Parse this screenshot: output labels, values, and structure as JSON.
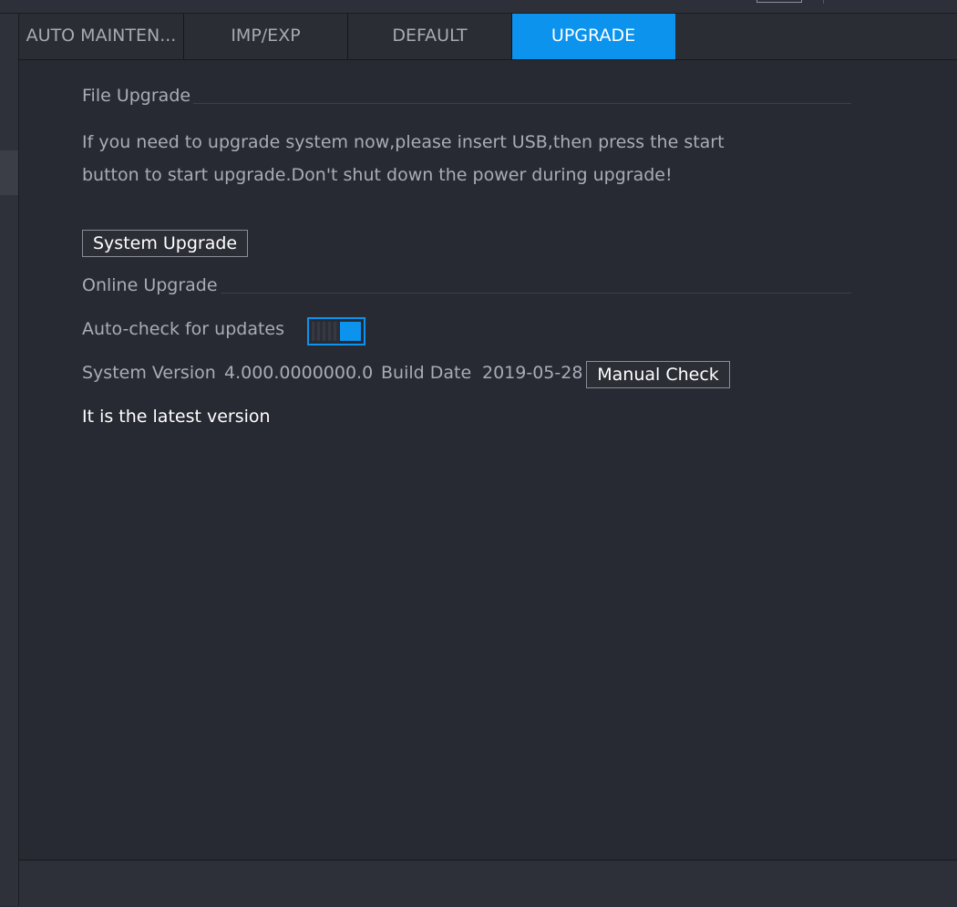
{
  "tabs": [
    {
      "label": "AUTO MAINTEN..."
    },
    {
      "label": "IMP/EXP"
    },
    {
      "label": "DEFAULT"
    },
    {
      "label": "UPGRADE",
      "active": true
    }
  ],
  "file_upgrade": {
    "title": "File Upgrade",
    "description_line1": "If you need to upgrade system now,please insert USB,then press the start",
    "description_line2": "button to start upgrade.Don't shut down the power during upgrade!",
    "button_label": "System Upgrade"
  },
  "online_upgrade": {
    "title": "Online Upgrade",
    "auto_check_label": "Auto-check for updates",
    "auto_check_enabled": true,
    "system_version_label": "System Version",
    "system_version_value": "4.000.0000000.0",
    "build_date_label": "Build Date",
    "build_date_value": "2019-05-28",
    "manual_check_label": "Manual Check",
    "status_text": "It is the latest version"
  },
  "colors": {
    "accent": "#0c93ee",
    "background": "#282a33"
  }
}
